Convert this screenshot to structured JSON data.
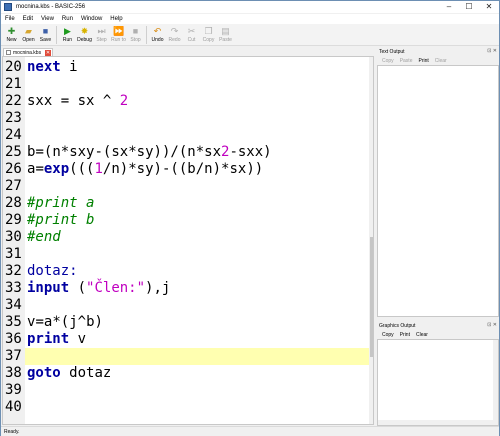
{
  "window": {
    "title": "mocnina.kbs - BASIC-256"
  },
  "titlebar_buttons": {
    "minimize": "–",
    "maximize": "☐",
    "close": "✕"
  },
  "menu": [
    "File",
    "Edit",
    "View",
    "Run",
    "Window",
    "Help"
  ],
  "toolbar": {
    "new": "New",
    "open": "Open",
    "save": "Save",
    "run": "Run",
    "debug": "Debug",
    "step": "Step",
    "run_to": "Run to",
    "stop": "Stop",
    "undo": "Undo",
    "redo": "Redo",
    "cut": "Cut",
    "copy": "Copy",
    "paste": "Paste"
  },
  "tab": {
    "label": "mocnina.kbs"
  },
  "editor": {
    "current_line": 37,
    "lines": [
      {
        "n": "20",
        "code": "next i"
      },
      {
        "n": "21",
        "code": ""
      },
      {
        "n": "22",
        "code": "sxx = sx ^ 2"
      },
      {
        "n": "23",
        "code": ""
      },
      {
        "n": "24",
        "code": ""
      },
      {
        "n": "25",
        "code": "b=(n*sxy-(sx*sy))/(n*sx2-sxx)"
      },
      {
        "n": "26",
        "code": "a=exp(((1/n)*sy)-((b/n)*sx))"
      },
      {
        "n": "27",
        "code": ""
      },
      {
        "n": "28",
        "code": "#print a"
      },
      {
        "n": "29",
        "code": "#print b"
      },
      {
        "n": "30",
        "code": "#end"
      },
      {
        "n": "31",
        "code": ""
      },
      {
        "n": "32",
        "code": "dotaz:"
      },
      {
        "n": "33",
        "code": "input (\"Člen:\"),j"
      },
      {
        "n": "34",
        "code": ""
      },
      {
        "n": "35",
        "code": "v=a*(j^b)"
      },
      {
        "n": "36",
        "code": "print v"
      },
      {
        "n": "37",
        "code": ""
      },
      {
        "n": "38",
        "code": "goto dotaz"
      },
      {
        "n": "39",
        "code": ""
      },
      {
        "n": "40",
        "code": ""
      }
    ]
  },
  "text_output": {
    "title": "Text Output",
    "buttons": {
      "copy": "Copy",
      "paste": "Paste",
      "print": "Print",
      "clear": "Clear"
    }
  },
  "graphics_output": {
    "title": "Graphics Output",
    "buttons": {
      "copy": "Copy",
      "print": "Print",
      "clear": "Clear"
    }
  },
  "panel_controls": "⊡ ✕",
  "status": {
    "text": "Ready."
  },
  "colors": {
    "keyword": "#0000a0",
    "comment": "#008000",
    "literal": "#c000c0",
    "current_line": "#ffffb0"
  }
}
